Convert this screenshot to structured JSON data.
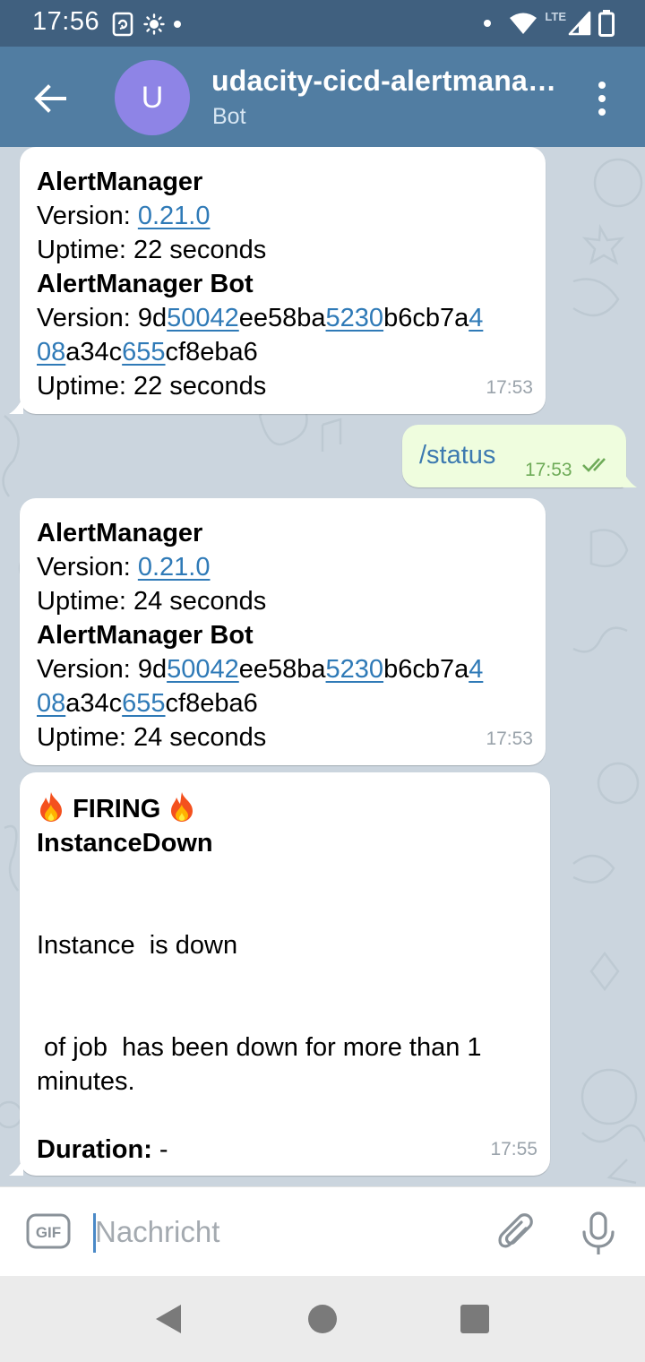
{
  "status_bar": {
    "time": "17:56",
    "network_label": "LTE",
    "icons": [
      "screen-rotate-icon",
      "brightness-icon",
      "notification-dot-icon",
      "wifi-icon",
      "signal-icon",
      "battery-icon"
    ]
  },
  "header": {
    "avatar_initial": "U",
    "title": "udacity-cicd-alertmanager",
    "subtitle": "Bot",
    "avatar_color": "#8e84e6",
    "bar_color": "#517da2"
  },
  "messages": [
    {
      "id": "msg1",
      "direction": "incoming",
      "am_title": "AlertManager",
      "am_version_label": "Version: ",
      "am_version": "0.21.0",
      "am_uptime": "Uptime: 22 seconds",
      "bot_title": "AlertManager Bot",
      "bot_version_label": "Version: ",
      "bot_version_parts": [
        "9d",
        "50042",
        "ee58ba",
        "5230",
        "b6cb7a",
        "4"
      ],
      "bot_version_parts_line2": [
        "08",
        "a34c",
        "655",
        "cf8eba6"
      ],
      "bot_uptime": "Uptime: 22 seconds",
      "time": "17:53"
    },
    {
      "id": "msg2",
      "direction": "outgoing",
      "text": "/status",
      "time": "17:53",
      "read": true
    },
    {
      "id": "msg3",
      "direction": "incoming",
      "am_title": "AlertManager",
      "am_version_label": "Version: ",
      "am_version": "0.21.0",
      "am_uptime": "Uptime: 24 seconds",
      "bot_title": "AlertManager Bot",
      "bot_version_label": "Version: ",
      "bot_version_parts": [
        "9d",
        "50042",
        "ee58ba",
        "5230",
        "b6cb7a",
        "4"
      ],
      "bot_version_parts_line2": [
        "08",
        "a34c",
        "655",
        "cf8eba6"
      ],
      "bot_uptime": "Uptime: 24 seconds",
      "time": "17:53"
    },
    {
      "id": "msg4",
      "direction": "incoming",
      "firing_label": "FIRING",
      "alert_name": "InstanceDown",
      "line_instance": "Instance  is down",
      "line_job": " of job  has been down for more than 1",
      "line_minutes": "minutes.",
      "duration_label": "Duration:",
      "duration_value": " -",
      "time": "17:55"
    }
  ],
  "input": {
    "placeholder": "Nachricht",
    "gif_label": "GIF",
    "value": ""
  },
  "colors": {
    "link": "#2f7ab7",
    "outgoing_bubble": "#effdde",
    "outgoing_meta": "#6eab58"
  }
}
